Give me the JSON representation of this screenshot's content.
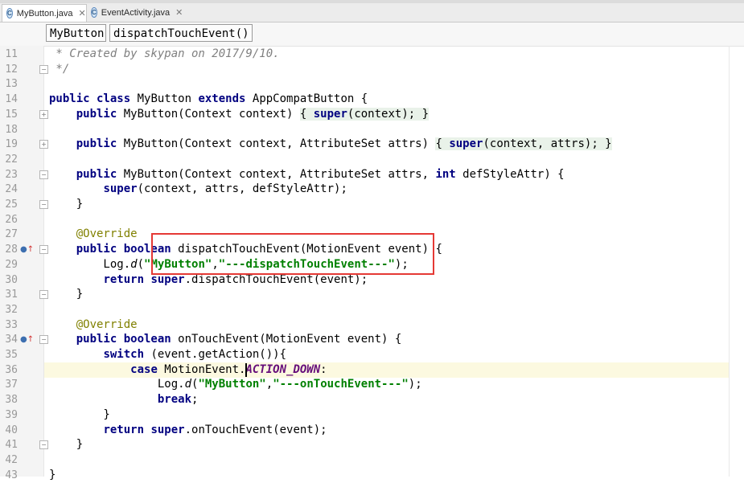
{
  "tabs": [
    {
      "label": "MyButton.java",
      "icon": "class-icon",
      "active": true
    },
    {
      "label": "EventActivity.java",
      "icon": "class-icon",
      "active": false
    }
  ],
  "breadcrumbs": [
    "MyButton",
    "dispatchTouchEvent()"
  ],
  "lines": [
    {
      "n": "11",
      "segs": [
        {
          "t": " * Created by skypan on 2017/9/10.",
          "c": "com"
        }
      ]
    },
    {
      "n": "12",
      "segs": [
        {
          "t": " */",
          "c": "com"
        }
      ]
    },
    {
      "n": "13",
      "segs": []
    },
    {
      "n": "14",
      "segs": [
        {
          "t": "public class",
          "c": "kw"
        },
        {
          "t": " MyButton "
        },
        {
          "t": "extends",
          "c": "kw"
        },
        {
          "t": " AppCompatButton {"
        }
      ]
    },
    {
      "n": "15",
      "segs": [
        {
          "t": "    "
        },
        {
          "t": "public",
          "c": "kw"
        },
        {
          "t": " MyButton(Context context) "
        },
        {
          "t": "{ ",
          "c": "fold"
        },
        {
          "t": "super",
          "c": "kw fold"
        },
        {
          "t": "(context); }",
          "c": "fold"
        }
      ]
    },
    {
      "n": "18",
      "segs": []
    },
    {
      "n": "19",
      "segs": [
        {
          "t": "    "
        },
        {
          "t": "public",
          "c": "kw"
        },
        {
          "t": " MyButton(Context context, AttributeSet attrs) "
        },
        {
          "t": "{ ",
          "c": "fold"
        },
        {
          "t": "super",
          "c": "kw fold"
        },
        {
          "t": "(context, attrs); }",
          "c": "fold"
        }
      ]
    },
    {
      "n": "22",
      "segs": []
    },
    {
      "n": "23",
      "segs": [
        {
          "t": "    "
        },
        {
          "t": "public",
          "c": "kw"
        },
        {
          "t": " MyButton(Context context, AttributeSet attrs, "
        },
        {
          "t": "int",
          "c": "kw"
        },
        {
          "t": " defStyleAttr) {"
        }
      ]
    },
    {
      "n": "24",
      "segs": [
        {
          "t": "        "
        },
        {
          "t": "super",
          "c": "kw"
        },
        {
          "t": "(context, attrs, defStyleAttr);"
        }
      ]
    },
    {
      "n": "25",
      "segs": [
        {
          "t": "    }"
        }
      ]
    },
    {
      "n": "26",
      "segs": []
    },
    {
      "n": "27",
      "segs": [
        {
          "t": "    "
        },
        {
          "t": "@Override",
          "c": "ann"
        }
      ]
    },
    {
      "n": "28",
      "segs": [
        {
          "t": "    "
        },
        {
          "t": "public boolean",
          "c": "kw"
        },
        {
          "t": " dispatchTouchEvent(MotionEvent event) {"
        }
      ]
    },
    {
      "n": "29",
      "segs": [
        {
          "t": "        Log."
        },
        {
          "t": "d",
          "c": "itl"
        },
        {
          "t": "("
        },
        {
          "t": "\"MyButton\"",
          "c": "str"
        },
        {
          "t": ","
        },
        {
          "t": "\"---dispatchTouchEvent---\"",
          "c": "str"
        },
        {
          "t": ");"
        }
      ]
    },
    {
      "n": "30",
      "segs": [
        {
          "t": "        "
        },
        {
          "t": "return super",
          "c": "kw"
        },
        {
          "t": ".dispatchTouchEvent(event);"
        }
      ]
    },
    {
      "n": "31",
      "segs": [
        {
          "t": "    }"
        }
      ]
    },
    {
      "n": "32",
      "segs": []
    },
    {
      "n": "33",
      "segs": [
        {
          "t": "    "
        },
        {
          "t": "@Override",
          "c": "ann"
        }
      ]
    },
    {
      "n": "34",
      "segs": [
        {
          "t": "    "
        },
        {
          "t": "public boolean",
          "c": "kw"
        },
        {
          "t": " onTouchEvent(MotionEvent event) {"
        }
      ]
    },
    {
      "n": "35",
      "segs": [
        {
          "t": "        "
        },
        {
          "t": "switch",
          "c": "kw"
        },
        {
          "t": " (event.getAction()){"
        }
      ]
    },
    {
      "n": "36",
      "segs": [
        {
          "t": "            "
        },
        {
          "t": "case",
          "c": "kw"
        },
        {
          "t": " MotionEvent."
        },
        {
          "t": "ACTION_DOWN",
          "c": "const"
        },
        {
          "t": ":"
        }
      ]
    },
    {
      "n": "37",
      "segs": [
        {
          "t": "                Log."
        },
        {
          "t": "d",
          "c": "itl"
        },
        {
          "t": "("
        },
        {
          "t": "\"MyButton\"",
          "c": "str"
        },
        {
          "t": ","
        },
        {
          "t": "\"---onTouchEvent---\"",
          "c": "str"
        },
        {
          "t": ");"
        }
      ]
    },
    {
      "n": "38",
      "segs": [
        {
          "t": "                "
        },
        {
          "t": "break",
          "c": "kw"
        },
        {
          "t": ";"
        }
      ]
    },
    {
      "n": "39",
      "segs": [
        {
          "t": "        }"
        }
      ]
    },
    {
      "n": "40",
      "segs": [
        {
          "t": "        "
        },
        {
          "t": "return super",
          "c": "kw"
        },
        {
          "t": ".onTouchEvent(event);"
        }
      ]
    },
    {
      "n": "41",
      "segs": [
        {
          "t": "    }"
        }
      ]
    },
    {
      "n": "42",
      "segs": []
    },
    {
      "n": "43",
      "segs": [
        {
          "t": "}"
        }
      ]
    }
  ],
  "gutter_markers": {
    "fold_lines": [
      "12",
      "15",
      "19",
      "23",
      "25",
      "28",
      "31",
      "34",
      "41"
    ],
    "override_lines": [
      "28",
      "34"
    ]
  },
  "highlight_color": "#e53935",
  "caret_line": "36"
}
